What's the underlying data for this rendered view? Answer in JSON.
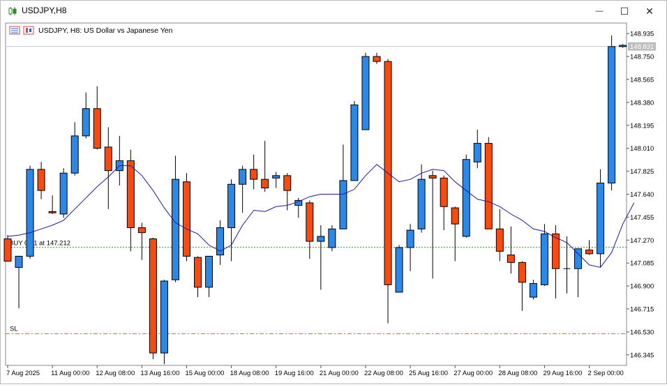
{
  "window": {
    "title": "USDJPY,H8",
    "minimize_glyph": "—",
    "maximize_glyph": "☐",
    "close_glyph": "✕"
  },
  "chart_header": {
    "label": "USDJPY, H8:  US Dollar vs Japanese Yen"
  },
  "colors": {
    "bull": "#2b88e8",
    "bear": "#fa4a10",
    "ma": "#1a1aa6",
    "grid_border": "#888888",
    "buy_line": "#3a9a3a",
    "sl_line": "#e0603a",
    "price_tag_bg": "#bdbdbd"
  },
  "chart_data": {
    "type": "candlestick",
    "symbol": "USDJPY",
    "timeframe": "H8",
    "ylim": [
      146.26,
      149.02
    ],
    "y_ticks": [
      "148.935",
      "148.750",
      "148.565",
      "148.380",
      "148.195",
      "148.010",
      "147.825",
      "147.640",
      "147.455",
      "147.270",
      "147.085",
      "146.900",
      "146.715",
      "146.530",
      "146.345"
    ],
    "x_tick_labels": [
      {
        "index": 0,
        "label": "7 Aug 2025"
      },
      {
        "index": 4,
        "label": "11 Aug 00:00"
      },
      {
        "index": 8,
        "label": "12 Aug 08:00"
      },
      {
        "index": 12,
        "label": "13 Aug 16:00"
      },
      {
        "index": 16,
        "label": "15 Aug 00:00"
      },
      {
        "index": 20,
        "label": "18 Aug 08:00"
      },
      {
        "index": 24,
        "label": "19 Aug 16:00"
      },
      {
        "index": 28,
        "label": "21 Aug 00:00"
      },
      {
        "index": 32,
        "label": "22 Aug 08:00"
      },
      {
        "index": 36,
        "label": "25 Aug 16:00"
      },
      {
        "index": 40,
        "label": "27 Aug 00:00"
      },
      {
        "index": 44,
        "label": "28 Aug 08:00"
      },
      {
        "index": 48,
        "label": "29 Aug 16:00"
      },
      {
        "index": 52,
        "label": "2 Sep 00:00"
      }
    ],
    "candles": [
      {
        "o": 147.28,
        "h": 147.31,
        "l": 147.1,
        "c": 147.1
      },
      {
        "o": 147.05,
        "h": 147.14,
        "l": 146.72,
        "c": 147.14
      },
      {
        "o": 147.14,
        "h": 147.87,
        "l": 147.12,
        "c": 147.84
      },
      {
        "o": 147.84,
        "h": 147.9,
        "l": 147.6,
        "c": 147.67
      },
      {
        "o": 147.5,
        "h": 147.63,
        "l": 147.48,
        "c": 147.49
      },
      {
        "o": 147.48,
        "h": 147.85,
        "l": 147.45,
        "c": 147.81
      },
      {
        "o": 147.81,
        "h": 148.22,
        "l": 147.79,
        "c": 148.11
      },
      {
        "o": 148.11,
        "h": 148.46,
        "l": 148.09,
        "c": 148.33
      },
      {
        "o": 148.33,
        "h": 148.51,
        "l": 148.0,
        "c": 148.01
      },
      {
        "o": 148.02,
        "h": 148.18,
        "l": 147.52,
        "c": 147.83
      },
      {
        "o": 147.83,
        "h": 148.11,
        "l": 147.71,
        "c": 147.91
      },
      {
        "o": 147.91,
        "h": 148.0,
        "l": 147.18,
        "c": 147.37
      },
      {
        "o": 147.37,
        "h": 147.41,
        "l": 147.11,
        "c": 147.33
      },
      {
        "o": 147.28,
        "h": 147.29,
        "l": 146.31,
        "c": 146.36
      },
      {
        "o": 146.36,
        "h": 146.95,
        "l": 146.27,
        "c": 146.94
      },
      {
        "o": 146.95,
        "h": 147.95,
        "l": 146.93,
        "c": 147.76
      },
      {
        "o": 147.74,
        "h": 147.81,
        "l": 147.1,
        "c": 147.14
      },
      {
        "o": 147.13,
        "h": 147.14,
        "l": 146.81,
        "c": 146.89
      },
      {
        "o": 146.89,
        "h": 147.13,
        "l": 146.81,
        "c": 147.14
      },
      {
        "o": 147.15,
        "h": 147.43,
        "l": 147.07,
        "c": 147.37
      },
      {
        "o": 147.37,
        "h": 147.76,
        "l": 147.1,
        "c": 147.72
      },
      {
        "o": 147.72,
        "h": 147.87,
        "l": 147.49,
        "c": 147.84
      },
      {
        "o": 147.84,
        "h": 147.96,
        "l": 147.68,
        "c": 147.76
      },
      {
        "o": 147.76,
        "h": 148.07,
        "l": 147.66,
        "c": 147.69
      },
      {
        "o": 147.77,
        "h": 147.82,
        "l": 147.69,
        "c": 147.79
      },
      {
        "o": 147.79,
        "h": 147.81,
        "l": 147.51,
        "c": 147.67
      },
      {
        "o": 147.55,
        "h": 147.61,
        "l": 147.45,
        "c": 147.59
      },
      {
        "o": 147.57,
        "h": 147.59,
        "l": 147.12,
        "c": 147.26
      },
      {
        "o": 147.26,
        "h": 147.39,
        "l": 146.87,
        "c": 147.3
      },
      {
        "o": 147.21,
        "h": 147.39,
        "l": 147.18,
        "c": 147.36
      },
      {
        "o": 147.36,
        "h": 148.04,
        "l": 147.36,
        "c": 147.75
      },
      {
        "o": 147.75,
        "h": 148.39,
        "l": 147.75,
        "c": 148.36
      },
      {
        "o": 148.16,
        "h": 148.78,
        "l": 148.16,
        "c": 148.75
      },
      {
        "o": 148.75,
        "h": 148.78,
        "l": 148.69,
        "c": 148.71
      },
      {
        "o": 148.71,
        "h": 148.73,
        "l": 146.6,
        "c": 146.91
      },
      {
        "o": 146.85,
        "h": 147.23,
        "l": 146.85,
        "c": 147.21
      },
      {
        "o": 147.21,
        "h": 147.4,
        "l": 147.02,
        "c": 147.35
      },
      {
        "o": 147.36,
        "h": 147.88,
        "l": 147.33,
        "c": 147.76
      },
      {
        "o": 147.79,
        "h": 147.83,
        "l": 146.96,
        "c": 147.77
      },
      {
        "o": 147.77,
        "h": 147.79,
        "l": 147.35,
        "c": 147.54
      },
      {
        "o": 147.53,
        "h": 147.54,
        "l": 147.1,
        "c": 147.4
      },
      {
        "o": 147.3,
        "h": 147.96,
        "l": 147.29,
        "c": 147.92
      },
      {
        "o": 147.9,
        "h": 148.16,
        "l": 147.85,
        "c": 148.05
      },
      {
        "o": 148.05,
        "h": 148.1,
        "l": 147.43,
        "c": 147.36
      },
      {
        "o": 147.36,
        "h": 147.52,
        "l": 147.1,
        "c": 147.18
      },
      {
        "o": 147.15,
        "h": 147.38,
        "l": 147.0,
        "c": 147.09
      },
      {
        "o": 147.09,
        "h": 147.1,
        "l": 146.7,
        "c": 146.93
      },
      {
        "o": 146.81,
        "h": 146.95,
        "l": 146.79,
        "c": 146.92
      },
      {
        "o": 146.91,
        "h": 147.4,
        "l": 146.9,
        "c": 147.32
      },
      {
        "o": 147.32,
        "h": 147.39,
        "l": 146.8,
        "c": 147.04
      },
      {
        "o": 147.04,
        "h": 147.3,
        "l": 146.84,
        "c": 147.04
      },
      {
        "o": 147.04,
        "h": 147.19,
        "l": 146.81,
        "c": 147.2
      },
      {
        "o": 147.19,
        "h": 147.27,
        "l": 147.15,
        "c": 147.16
      },
      {
        "o": 147.16,
        "h": 147.84,
        "l": 147.05,
        "c": 147.73
      },
      {
        "o": 147.73,
        "h": 148.92,
        "l": 147.67,
        "c": 148.83
      },
      {
        "o": 148.83,
        "h": 148.85,
        "l": 148.82,
        "c": 148.84
      }
    ],
    "ma": [
      147.3,
      147.31,
      147.33,
      147.36,
      147.39,
      147.43,
      147.52,
      147.61,
      147.7,
      147.78,
      147.87,
      147.87,
      147.79,
      147.67,
      147.53,
      147.41,
      147.36,
      147.32,
      147.23,
      147.18,
      147.23,
      147.39,
      147.51,
      147.5,
      147.54,
      147.55,
      147.58,
      147.62,
      147.64,
      147.64,
      147.64,
      147.68,
      147.79,
      147.88,
      147.81,
      147.74,
      147.76,
      147.81,
      147.84,
      147.83,
      147.74,
      147.67,
      147.6,
      147.58,
      147.54,
      147.48,
      147.43,
      147.36,
      147.34,
      147.29,
      147.25,
      147.16,
      147.07,
      147.05,
      147.17,
      147.4,
      147.57
    ],
    "current_price": "148.831",
    "current_price_value": 148.831,
    "buy_label": "BUY 0.01 at 147.212",
    "buy_price": 147.212,
    "sl_label": "SL",
    "sl_price": 146.515
  }
}
